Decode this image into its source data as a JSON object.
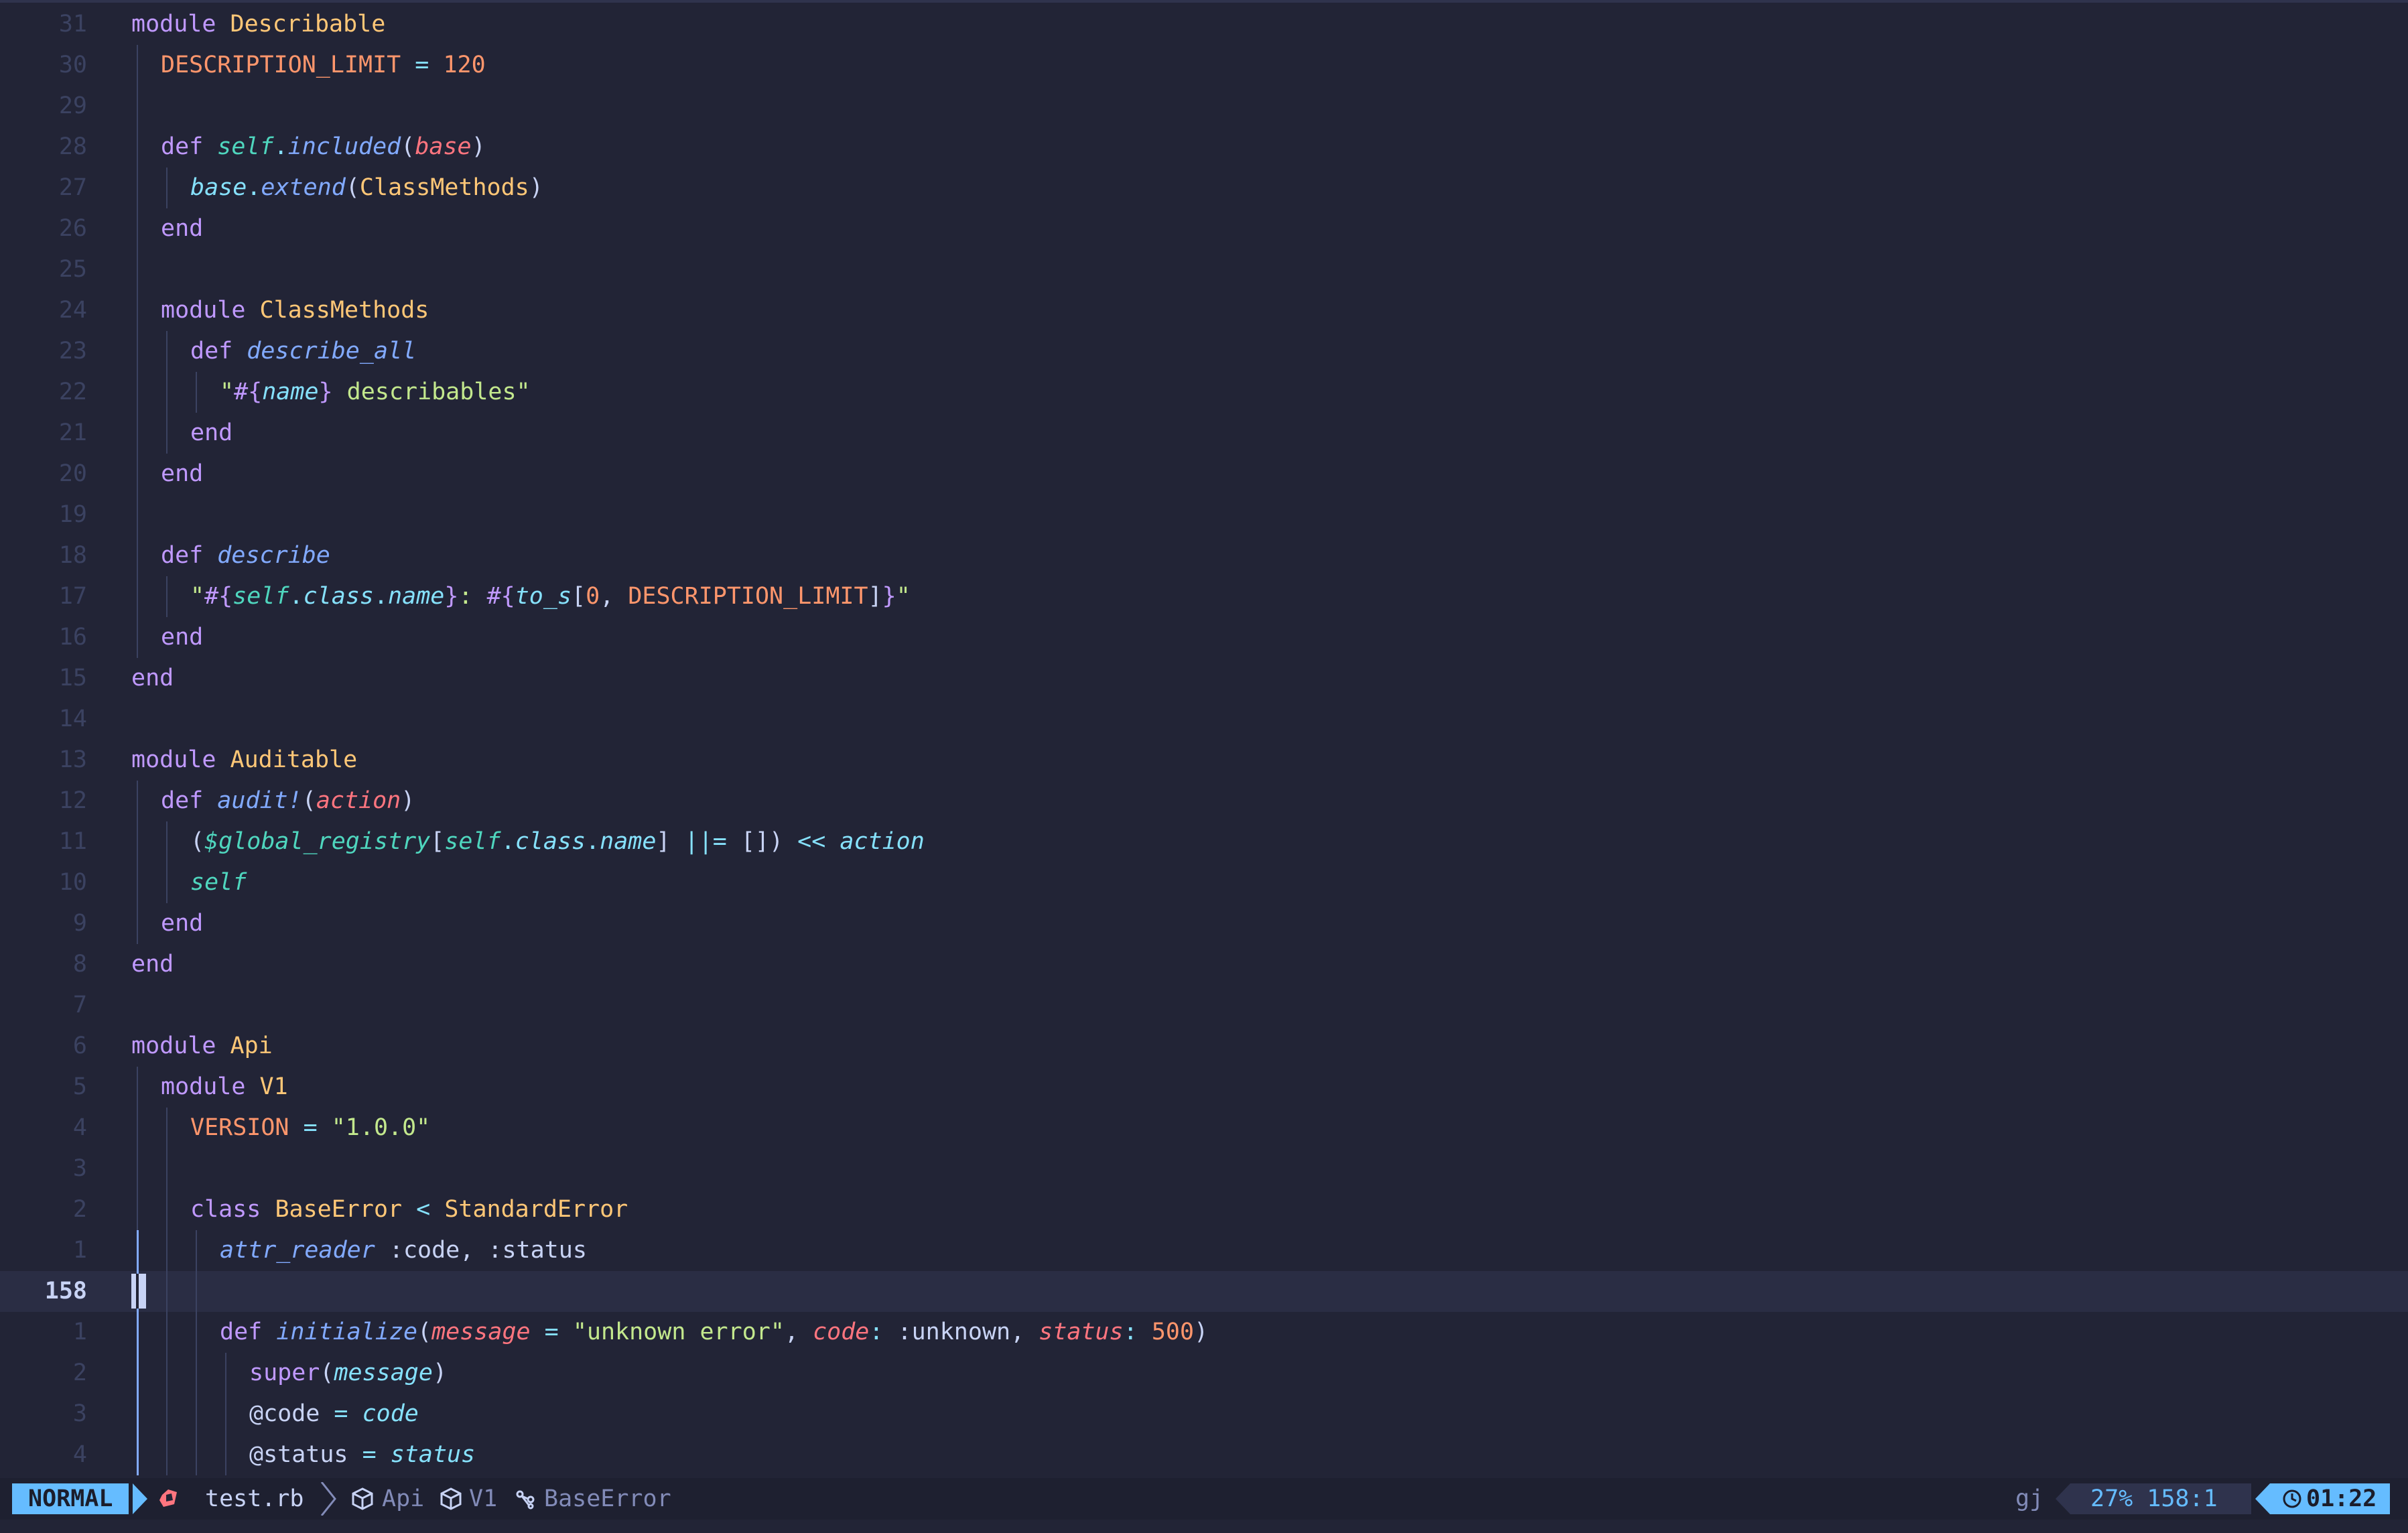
{
  "editor": {
    "lines": [
      {
        "num": "31",
        "indent": 0,
        "tokens": [
          [
            "k",
            "module"
          ],
          [
            "pl",
            " "
          ],
          [
            "c",
            "Describable"
          ]
        ]
      },
      {
        "num": "30",
        "indent": 1,
        "tokens": [
          [
            "cn",
            "DESCRIPTION_LIMIT"
          ],
          [
            "o",
            " = "
          ],
          [
            "n",
            "120"
          ]
        ]
      },
      {
        "num": "29",
        "indent": 1,
        "tokens": []
      },
      {
        "num": "28",
        "indent": 1,
        "tokens": [
          [
            "k",
            "def"
          ],
          [
            "pl",
            " "
          ],
          [
            "sf",
            "self"
          ],
          [
            "o",
            "."
          ],
          [
            "f",
            "included"
          ],
          [
            "br",
            "("
          ],
          [
            "p",
            "base"
          ],
          [
            "br",
            ")"
          ]
        ]
      },
      {
        "num": "27",
        "indent": 2,
        "tokens": [
          [
            "v",
            "base"
          ],
          [
            "o",
            "."
          ],
          [
            "f",
            "extend"
          ],
          [
            "br",
            "("
          ],
          [
            "c",
            "ClassMethods"
          ],
          [
            "br",
            ")"
          ]
        ]
      },
      {
        "num": "26",
        "indent": 1,
        "tokens": [
          [
            "k",
            "end"
          ]
        ]
      },
      {
        "num": "25",
        "indent": 1,
        "tokens": []
      },
      {
        "num": "24",
        "indent": 1,
        "tokens": [
          [
            "k",
            "module"
          ],
          [
            "pl",
            " "
          ],
          [
            "c",
            "ClassMethods"
          ]
        ]
      },
      {
        "num": "23",
        "indent": 2,
        "tokens": [
          [
            "k",
            "def"
          ],
          [
            "pl",
            " "
          ],
          [
            "f",
            "describe_all"
          ]
        ]
      },
      {
        "num": "22",
        "indent": 3,
        "tokens": [
          [
            "s",
            "\""
          ],
          [
            "i",
            "#{"
          ],
          [
            "v",
            "name"
          ],
          [
            "i",
            "}"
          ],
          [
            "s",
            " describables\""
          ]
        ]
      },
      {
        "num": "21",
        "indent": 2,
        "tokens": [
          [
            "k",
            "end"
          ]
        ]
      },
      {
        "num": "20",
        "indent": 1,
        "tokens": [
          [
            "k",
            "end"
          ]
        ]
      },
      {
        "num": "19",
        "indent": 1,
        "tokens": []
      },
      {
        "num": "18",
        "indent": 1,
        "tokens": [
          [
            "k",
            "def"
          ],
          [
            "pl",
            " "
          ],
          [
            "f",
            "describe"
          ]
        ]
      },
      {
        "num": "17",
        "indent": 2,
        "tokens": [
          [
            "s",
            "\""
          ],
          [
            "i",
            "#{"
          ],
          [
            "sf",
            "self"
          ],
          [
            "o",
            "."
          ],
          [
            "v",
            "class"
          ],
          [
            "o",
            "."
          ],
          [
            "v",
            "name"
          ],
          [
            "i",
            "}"
          ],
          [
            "s",
            ": "
          ],
          [
            "i",
            "#{"
          ],
          [
            "v",
            "to_s"
          ],
          [
            "br",
            "["
          ],
          [
            "n",
            "0"
          ],
          [
            "pl",
            ", "
          ],
          [
            "cn",
            "DESCRIPTION_LIMIT"
          ],
          [
            "br",
            "]"
          ],
          [
            "i",
            "}"
          ],
          [
            "s",
            "\""
          ]
        ]
      },
      {
        "num": "16",
        "indent": 1,
        "tokens": [
          [
            "k",
            "end"
          ]
        ]
      },
      {
        "num": "15",
        "indent": 0,
        "tokens": [
          [
            "k",
            "end"
          ]
        ]
      },
      {
        "num": "14",
        "indent": 0,
        "tokens": []
      },
      {
        "num": "13",
        "indent": 0,
        "tokens": [
          [
            "k",
            "module"
          ],
          [
            "pl",
            " "
          ],
          [
            "c",
            "Auditable"
          ]
        ]
      },
      {
        "num": "12",
        "indent": 1,
        "tokens": [
          [
            "k",
            "def"
          ],
          [
            "pl",
            " "
          ],
          [
            "f",
            "audit!"
          ],
          [
            "br",
            "("
          ],
          [
            "p",
            "action"
          ],
          [
            "br",
            ")"
          ]
        ]
      },
      {
        "num": "11",
        "indent": 2,
        "tokens": [
          [
            "br",
            "("
          ],
          [
            "gv",
            "$global_registry"
          ],
          [
            "br",
            "["
          ],
          [
            "sf",
            "self"
          ],
          [
            "o",
            "."
          ],
          [
            "v",
            "class"
          ],
          [
            "o",
            "."
          ],
          [
            "v",
            "name"
          ],
          [
            "br",
            "]"
          ],
          [
            "o",
            " ||= "
          ],
          [
            "br",
            "[]"
          ],
          [
            "br",
            ")"
          ],
          [
            "o",
            " << "
          ],
          [
            "v",
            "action"
          ]
        ]
      },
      {
        "num": "10",
        "indent": 2,
        "tokens": [
          [
            "sf",
            "self"
          ]
        ]
      },
      {
        "num": "9",
        "indent": 1,
        "tokens": [
          [
            "k",
            "end"
          ]
        ]
      },
      {
        "num": "8",
        "indent": 0,
        "tokens": [
          [
            "k",
            "end"
          ]
        ]
      },
      {
        "num": "7",
        "indent": 0,
        "tokens": []
      },
      {
        "num": "6",
        "indent": 0,
        "tokens": [
          [
            "k",
            "module"
          ],
          [
            "pl",
            " "
          ],
          [
            "c",
            "Api"
          ]
        ]
      },
      {
        "num": "5",
        "indent": 1,
        "tokens": [
          [
            "k",
            "module"
          ],
          [
            "pl",
            " "
          ],
          [
            "c",
            "V1"
          ]
        ]
      },
      {
        "num": "4",
        "indent": 2,
        "tokens": [
          [
            "cn",
            "VERSION"
          ],
          [
            "o",
            " = "
          ],
          [
            "s",
            "\"1.0.0\""
          ]
        ]
      },
      {
        "num": "3",
        "indent": 2,
        "tokens": []
      },
      {
        "num": "2",
        "indent": 2,
        "tokens": [
          [
            "k",
            "class"
          ],
          [
            "pl",
            " "
          ],
          [
            "c",
            "BaseError"
          ],
          [
            "o",
            " < "
          ],
          [
            "c",
            "StandardError"
          ]
        ]
      },
      {
        "num": "1",
        "indent": 3,
        "tokens": [
          [
            "f",
            "attr_reader"
          ],
          [
            "pl",
            " "
          ],
          [
            "sy",
            ":code"
          ],
          [
            "pl",
            ", "
          ],
          [
            "sy",
            ":status"
          ]
        ]
      },
      {
        "num": "158",
        "indent": 3,
        "current": true,
        "tokens": []
      },
      {
        "num": "1",
        "indent": 3,
        "tokens": [
          [
            "k",
            "def"
          ],
          [
            "pl",
            " "
          ],
          [
            "f",
            "initialize"
          ],
          [
            "br",
            "("
          ],
          [
            "p",
            "message"
          ],
          [
            "o",
            " = "
          ],
          [
            "s",
            "\"unknown error\""
          ],
          [
            "pl",
            ", "
          ],
          [
            "p",
            "code"
          ],
          [
            "o",
            ": "
          ],
          [
            "sy",
            ":unknown"
          ],
          [
            "pl",
            ", "
          ],
          [
            "p",
            "status"
          ],
          [
            "o",
            ": "
          ],
          [
            "n",
            "500"
          ],
          [
            "br",
            ")"
          ]
        ]
      },
      {
        "num": "2",
        "indent": 4,
        "tokens": [
          [
            "k",
            "super"
          ],
          [
            "br",
            "("
          ],
          [
            "v",
            "message"
          ],
          [
            "br",
            ")"
          ]
        ]
      },
      {
        "num": "3",
        "indent": 4,
        "tokens": [
          [
            "at",
            "@code"
          ],
          [
            "o",
            " = "
          ],
          [
            "v",
            "code"
          ]
        ]
      },
      {
        "num": "4",
        "indent": 4,
        "tokens": [
          [
            "at",
            "@status"
          ],
          [
            "o",
            " = "
          ],
          [
            "v",
            "status"
          ]
        ]
      }
    ]
  },
  "statusline": {
    "mode": "NORMAL",
    "file_icon": "ruby-icon",
    "file_name": "test.rb",
    "breadcrumbs": [
      {
        "icon": "module-icon",
        "label": "Api"
      },
      {
        "icon": "module-icon",
        "label": "V1"
      },
      {
        "icon": "class-icon",
        "label": "BaseError"
      }
    ],
    "keys": "gj",
    "position": "27% 158:1",
    "clock": "01:22"
  },
  "colors": {
    "background": "#222436",
    "accent": "#65bcff",
    "keyword": "#c099ff",
    "type": "#ffc777",
    "number": "#ff966c",
    "string": "#c3e88d",
    "function": "#82aaff",
    "parameter": "#ff757f",
    "variable": "#86e1fc"
  }
}
